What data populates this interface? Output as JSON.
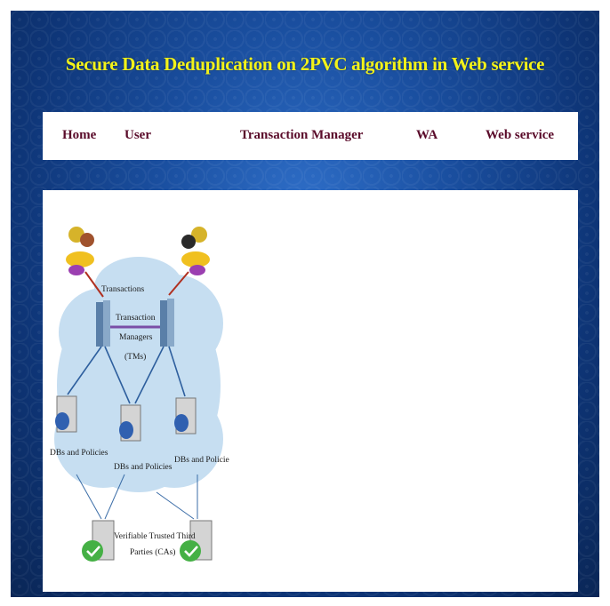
{
  "header": {
    "title": "Secure Data Deduplication on 2PVC algorithm in Web service"
  },
  "nav": {
    "home": "Home",
    "user": "User",
    "transaction_manager": "Transaction Manager",
    "wa": "WA",
    "web_service": "Web service"
  },
  "diagram": {
    "transactions": "Transactions",
    "tm_line1": "Transaction",
    "tm_line2": "Managers",
    "tm_line3": "(TMs)",
    "db_left": "DBs and Policies",
    "db_center": "DBs and Policies",
    "db_right": "DBs and Policies",
    "ttp_line1": "Verifiable Trusted Third",
    "ttp_line2": "Parties (CAs)"
  },
  "colors": {
    "title": "#f2f21a",
    "nav_text": "#5a0b2a",
    "background": "#1a4fa0",
    "cloud": "#bcd9ef"
  }
}
